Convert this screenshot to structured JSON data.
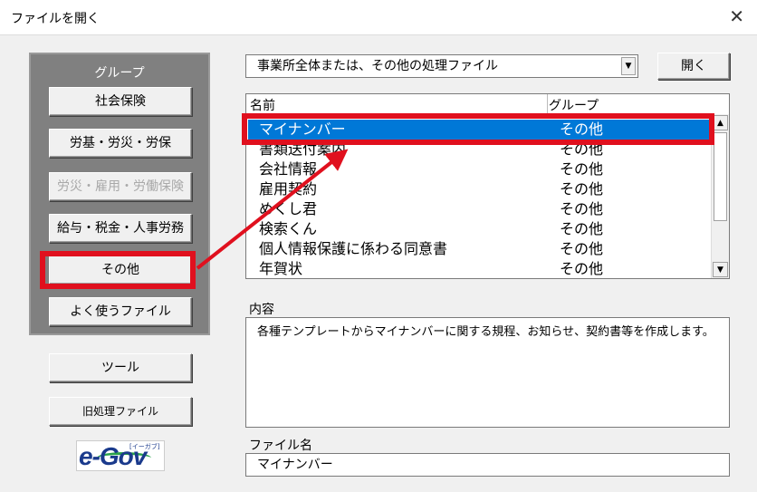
{
  "window": {
    "title": "ファイルを開く",
    "close_glyph": "✕"
  },
  "group_panel": {
    "label": "グループ",
    "buttons": [
      {
        "label": "社会保険",
        "enabled": true
      },
      {
        "label": "労基・労災・労保",
        "enabled": true
      },
      {
        "label": "労災・雇用・労働保険",
        "enabled": false
      },
      {
        "label": "給与・税金・人事労務",
        "enabled": true
      },
      {
        "label": "その他",
        "enabled": true
      },
      {
        "label": "よく使うファイル",
        "enabled": true
      }
    ]
  },
  "side_buttons": {
    "tools": "ツール",
    "old_files": "旧処理ファイル"
  },
  "egov_logo": {
    "text": "e-Gov",
    "tag": "[イーガブ]"
  },
  "combo": {
    "value": "事業所全体または、その他の処理ファイル",
    "arrow": "▼"
  },
  "open_button": "開く",
  "list": {
    "headers": [
      "名前",
      "グループ"
    ],
    "rows": [
      {
        "name": "マイナンバー",
        "group": "その他",
        "selected": true
      },
      {
        "name": "書類送付案内",
        "group": "その他"
      },
      {
        "name": "会社情報",
        "group": "その他"
      },
      {
        "name": "雇用契約",
        "group": "その他"
      },
      {
        "name": "めくし君",
        "group": "その他"
      },
      {
        "name": "検索くん",
        "group": "その他"
      },
      {
        "name": "個人情報保護に係わる同意書",
        "group": "その他"
      },
      {
        "name": "年賀状",
        "group": "その他"
      }
    ],
    "scroll_up": "▲",
    "scroll_down": "▼"
  },
  "content": {
    "label": "内容",
    "text": "各種テンプレートからマイナンバーに関する規程、お知らせ、契約書等を作成します。"
  },
  "filename": {
    "label": "ファイル名",
    "value": "マイナンバー"
  },
  "annotation_color": "#e0101e"
}
